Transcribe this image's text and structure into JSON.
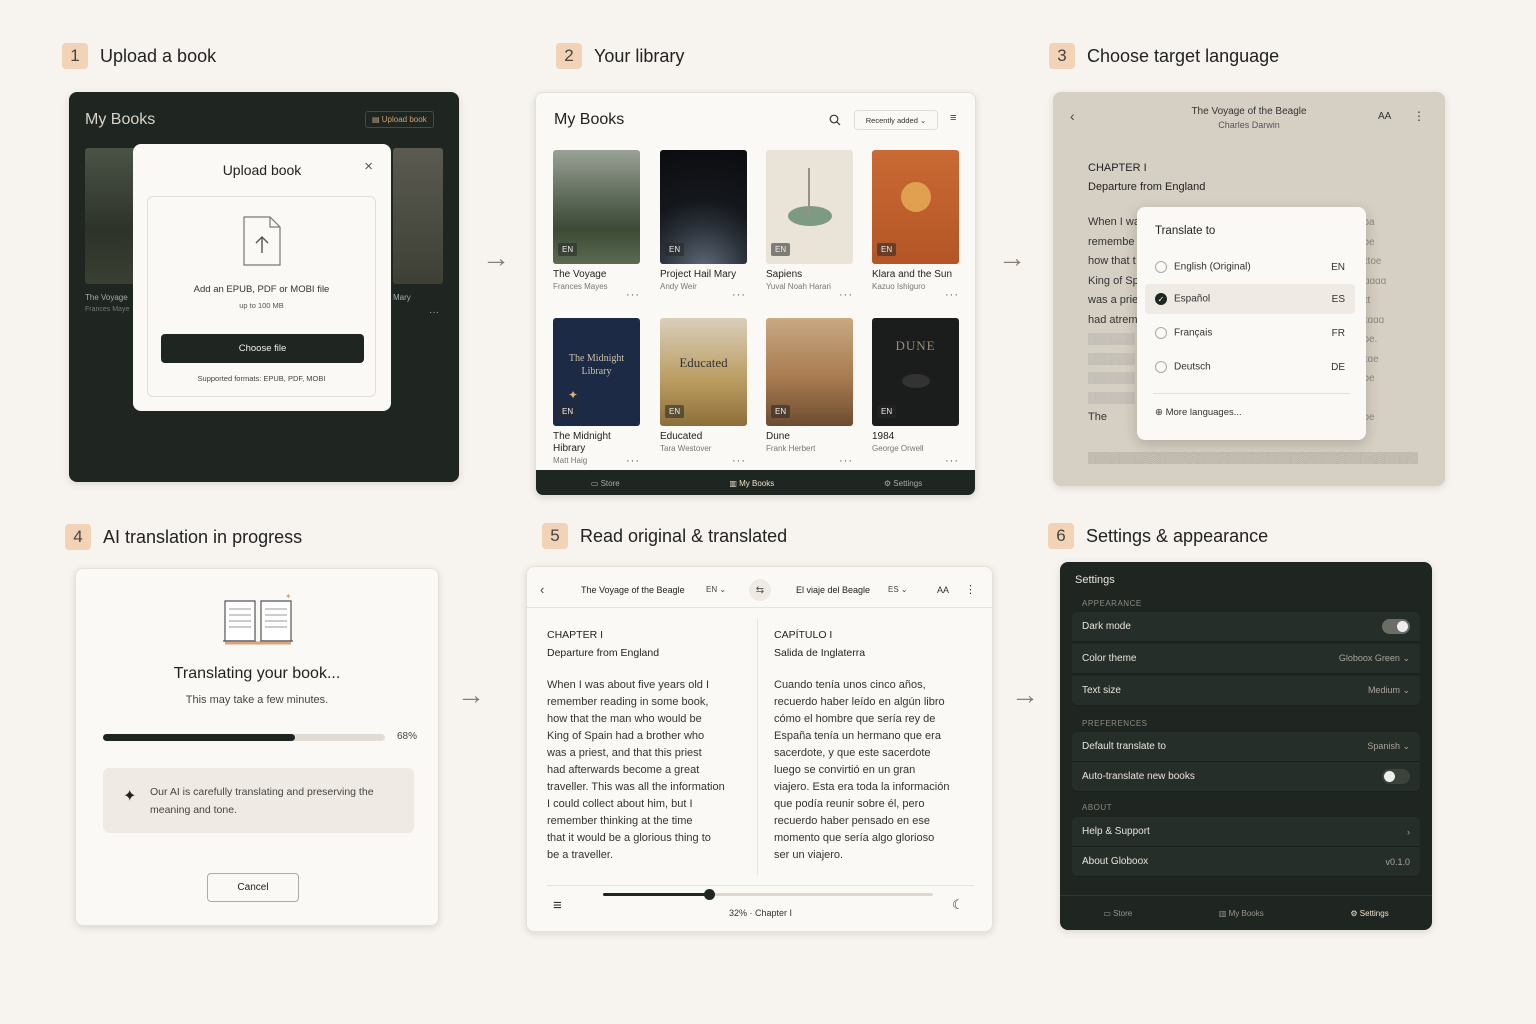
{
  "steps": [
    {
      "num": "1",
      "title": "Upload a book"
    },
    {
      "num": "2",
      "title": "Your library"
    },
    {
      "num": "3",
      "title": "Choose target language"
    },
    {
      "num": "4",
      "title": "AI translation in progress"
    },
    {
      "num": "5",
      "title": "Read original & translated"
    },
    {
      "num": "6",
      "title": "Settings & appearance"
    }
  ],
  "upload": {
    "header": "My Books",
    "upload_btn": "Upload book",
    "bg_title1": "The Voyage",
    "bg_author1": "Frances Maye",
    "bg_title2": "Mary",
    "modal_title": "Upload book",
    "drop_text": "Add an EPUB, PDF or MOBI file",
    "drop_sub": "up to 100 MB",
    "choose": "Choose file",
    "formats": "Supported formats: EPUB, PDF, MOBI"
  },
  "library": {
    "header": "My Books",
    "sort": "Recently added",
    "books": [
      {
        "title": "The Voyage",
        "author": "Frances Mayes",
        "lang": "EN"
      },
      {
        "title": "Project Hail Mary",
        "author": "Andy Weir",
        "lang": "EN"
      },
      {
        "title": "Sapiens",
        "author": "Yuval Noah Harari",
        "lang": "EN"
      },
      {
        "title": "Klara and the Sun",
        "author": "Kazuo Ishiguro",
        "lang": "EN"
      },
      {
        "title": "The Midnight Hibrary",
        "author": "Matt Haig",
        "lang": "EN"
      },
      {
        "title": "Educated",
        "author": "Tara Westover",
        "lang": "EN"
      },
      {
        "title": "Dune",
        "author": "Frank Herbert",
        "lang": "EN"
      },
      {
        "title": "1984",
        "author": "George Orwell",
        "lang": "EN"
      }
    ],
    "cover_midnight": "The Midnight Library",
    "cover_educated": "Educated",
    "cover_dune": "DUNE",
    "nav": [
      "Store",
      "My Books",
      "Settings"
    ]
  },
  "translate": {
    "book_title": "The Voyage of the Beagle",
    "book_author": "Charles Darwin",
    "aa": "AA",
    "chapter": "CHAPTER I",
    "chapter_sub": "Departure from England",
    "bg_lines": [
      "When I wa",
      "remembe",
      "how that t",
      "King of Sp",
      "was a prie",
      "had atrem",
      "The"
    ],
    "popup_title": "Translate to",
    "langs": [
      {
        "name": "English (Original)",
        "code": "EN"
      },
      {
        "name": "Español",
        "code": "ES"
      },
      {
        "name": "Français",
        "code": "FR"
      },
      {
        "name": "Deutsch",
        "code": "DE"
      }
    ],
    "more": "More languages..."
  },
  "progress": {
    "title": "Translating your book...",
    "sub": "This may take a few minutes.",
    "percent_label": "68%",
    "percent": 0.68,
    "info": "Our AI is carefully translating and preserving the meaning and tone.",
    "cancel": "Cancel"
  },
  "reader": {
    "orig_title": "The Voyage of the Beagle",
    "orig_lang": "EN",
    "trans_title": "El viaje del Beagle",
    "trans_lang": "ES",
    "aa": "AA",
    "orig_chapter": "CHAPTER I",
    "orig_sub": "Departure from England",
    "orig_text": [
      "When I was about five years old I",
      "remember reading in some book,",
      "how that the man who would be",
      "King of Spain had a brother who",
      "was a priest, and that this priest",
      "had afterwards become a great",
      "traveller. This was all the information",
      "I could collect about him, but I",
      "remember thinking at the time",
      "that it would be a glorious thing to",
      "be a traveller."
    ],
    "trans_chapter": "CAPÍTULO I",
    "trans_sub": "Salida de Inglaterra",
    "trans_text": [
      "Cuando tenía unos cinco años,",
      "recuerdo haber leído en algún libro",
      "cómo el hombre que sería rey de",
      "España tenía un hermano que era",
      "sacerdote, y que este sacerdote",
      "luego se convirtió en un gran",
      "viajero. Esta era toda la información",
      "que podía reunir sobre él, pero",
      "recuerdo haber pensado en ese",
      "momento que sería algo glorioso",
      "ser un viajero."
    ],
    "progress_label": "32% · Chapter I",
    "progress": 0.32
  },
  "settings": {
    "title": "Settings",
    "appearance": "APPEARANCE",
    "dark_mode": "Dark mode",
    "color_theme": "Color theme",
    "color_theme_val": "Globoox Green",
    "text_size": "Text size",
    "text_size_val": "Medium",
    "preferences": "PREFERENCES",
    "default_translate": "Default translate to",
    "default_translate_val": "Spanish",
    "auto_translate": "Auto-translate new books",
    "about": "ABOUT",
    "help": "Help & Support",
    "about_app": "About Globoox",
    "version": "v0.1.0",
    "nav": [
      "Store",
      "My Books",
      "Settings"
    ]
  },
  "colors": {
    "accent_dark": "#1f2621",
    "badge": "#f3d3b6",
    "background": "#f7f4ef"
  }
}
